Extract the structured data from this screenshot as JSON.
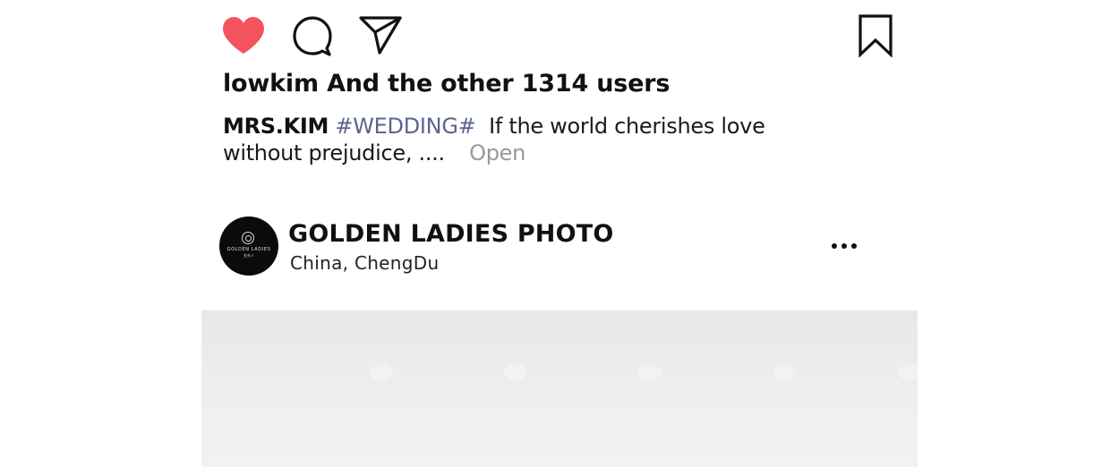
{
  "actions": {
    "like_icon": "heart-filled-icon",
    "like_color": "#f2535f",
    "comment_icon": "speech-bubble-icon",
    "share_icon": "paper-plane-icon",
    "save_icon": "bookmark-icon"
  },
  "likes": {
    "text": "lowkim And the other 1314 users"
  },
  "caption": {
    "author": "MRS.KIM",
    "hashtag": "#WEDDING#",
    "hashtag_color": "#5d6391",
    "text": "If the world cherishes love without prejudice, ....",
    "more_label": "Open"
  },
  "post": {
    "account_name": "GOLDEN LADIES PHOTO",
    "location": "China,  ChengDu",
    "avatar_brand": "GOLDEN LADIES",
    "avatar_sub": "金夫人",
    "more_icon": "more-horizontal-icon"
  }
}
